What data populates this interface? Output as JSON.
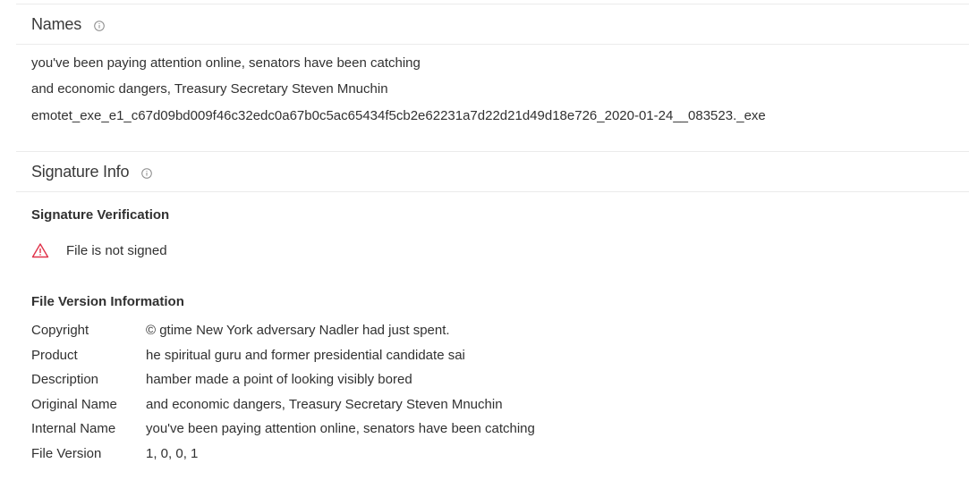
{
  "names_section": {
    "title": "Names",
    "info_icon": "info-circle-icon",
    "names": [
      "you've been paying attention online, senators have been catching",
      "and economic dangers, Treasury Secretary Steven Mnuchin",
      "emotet_exe_e1_c67d09bd009f46c32edc0a67b0c5ac65434f5cb2e62231a7d22d21d49d18e726_2020-01-24__083523._exe"
    ]
  },
  "signature_section": {
    "title": "Signature Info",
    "info_icon": "info-circle-icon",
    "verification_heading": "Signature Verification",
    "verification_status": "File is not signed",
    "warning_icon": "warning-triangle-icon",
    "warning_color": "#e0334a",
    "file_version_heading": "File Version Information",
    "file_version_rows": [
      {
        "key": "Copyright",
        "value": "© gtime New York adversary Nadler had just spent."
      },
      {
        "key": "Product",
        "value": "he spiritual guru and former presidential candidate sai"
      },
      {
        "key": "Description",
        "value": "hamber made a point of looking visibly bored"
      },
      {
        "key": "Original Name",
        "value": "and economic dangers, Treasury Secretary Steven Mnuchin"
      },
      {
        "key": "Internal Name",
        "value": "you've been paying attention online, senators have been catching"
      },
      {
        "key": "File Version",
        "value": "1, 0, 0, 1"
      }
    ]
  }
}
